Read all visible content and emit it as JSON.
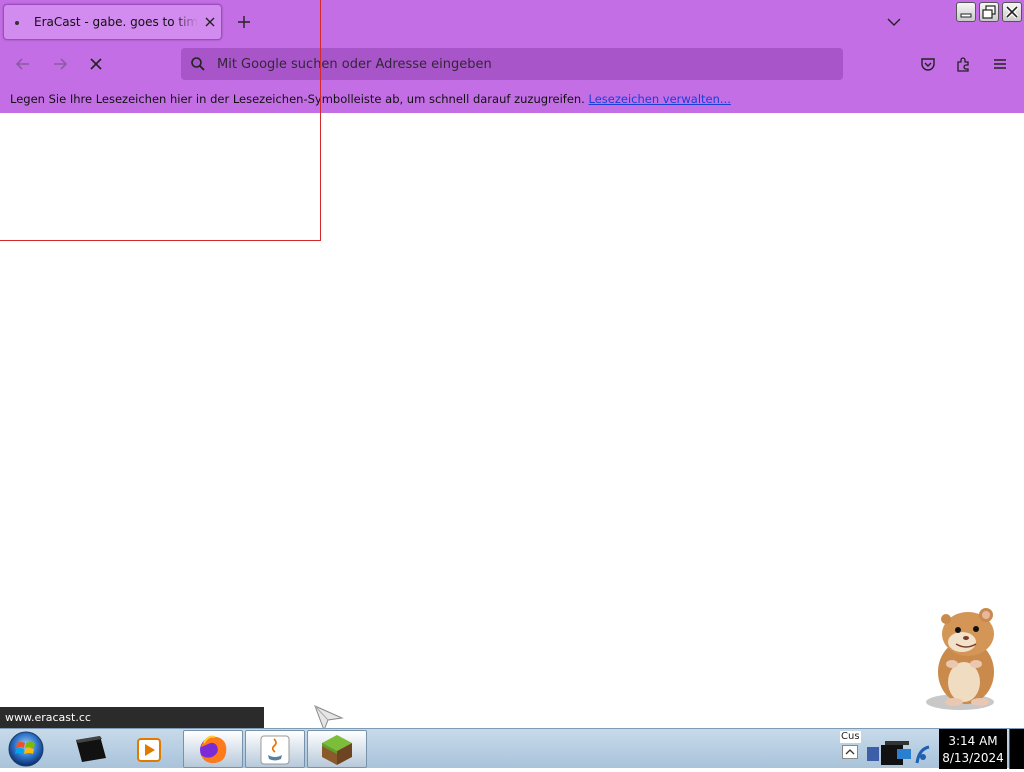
{
  "browser": {
    "tab": {
      "title": "EraCast - gabe. goes to times square"
    },
    "urlbar": {
      "placeholder": "Mit Google suchen oder Adresse eingeben"
    },
    "bookmarks_bar": {
      "message": "Legen Sie Ihre Lesezeichen hier in der Lesezeichen-Symbolleiste ab, um schnell darauf zuzugreifen.",
      "manage_link": "Lesezeichen verwalten..."
    },
    "status_url": "www.eracast.cc",
    "theme_color": "#c46ee6"
  },
  "taskbar": {
    "items": [
      {
        "name": "terminal",
        "icon": "black-box-icon"
      },
      {
        "name": "media-player",
        "icon": "play-icon"
      },
      {
        "name": "firefox",
        "icon": "firefox-icon"
      },
      {
        "name": "java",
        "icon": "java-icon"
      },
      {
        "name": "minecraft",
        "icon": "grass-block-icon"
      }
    ],
    "tray_label": "Cus",
    "clock": {
      "time": "3:14 AM",
      "date": "8/13/2024"
    }
  }
}
